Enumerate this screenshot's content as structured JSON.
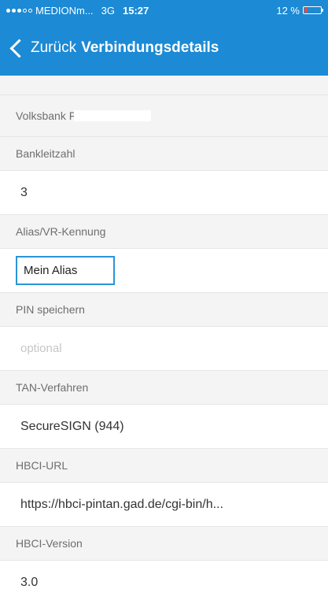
{
  "status_bar": {
    "carrier": "MEDIONm...",
    "network": "3G",
    "time": "15:27",
    "battery": "12 %"
  },
  "nav": {
    "back_label": "Zurück",
    "title": "Verbindungsdetails"
  },
  "bank": {
    "name_visible": "Volksbank F"
  },
  "fields": {
    "bankleitzahl": {
      "label": "Bankleitzahl",
      "value": "3"
    },
    "alias": {
      "label": "Alias/VR-Kennung",
      "value": "Mein Alias"
    },
    "pin": {
      "label": "PIN speichern",
      "placeholder": "optional"
    },
    "tan": {
      "label": "TAN-Verfahren",
      "value": "SecureSIGN (944)"
    },
    "hbci_url": {
      "label": "HBCI-URL",
      "value": "https://hbci-pintan.gad.de/cgi-bin/h..."
    },
    "hbci_version": {
      "label": "HBCI-Version",
      "value": "3.0"
    }
  },
  "colors": {
    "accent": "#1c8ad4",
    "input_border": "#2a95d8",
    "section_bg": "#f4f4f4"
  }
}
